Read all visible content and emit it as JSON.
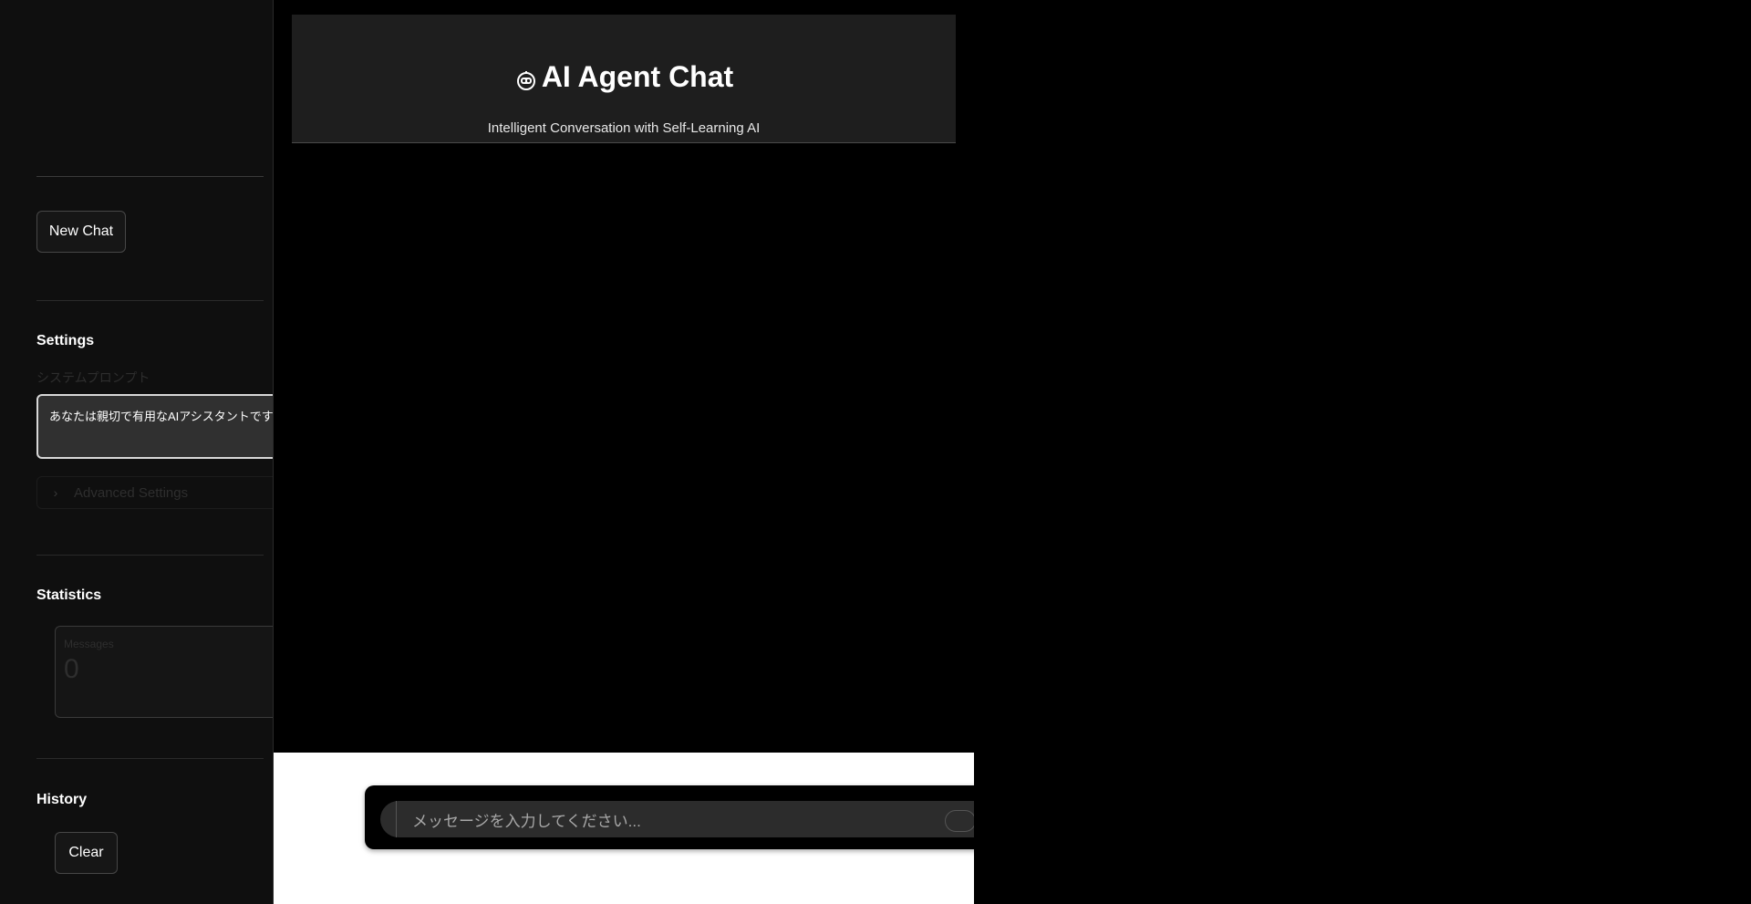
{
  "sidebar": {
    "new_chat_label": "New Chat",
    "settings_title": "Settings",
    "system_prompt_label": "システムプロンプト",
    "system_prompt_value": "あなたは親切で有用なAIアシスタントです。",
    "advanced_settings_label": "Advanced Settings",
    "statistics_title": "Statistics",
    "messages_label": "Messages",
    "messages_value": "0",
    "history_title": "History",
    "clear_label": "Clear"
  },
  "header": {
    "title": "AI Agent Chat",
    "subtitle": "Intelligent Conversation with Self-Learning AI",
    "icon": "robot-icon"
  },
  "chat": {
    "placeholder": "メッセージを入力してください..."
  },
  "colors": {
    "sidebar_bg": "#0f0f0f",
    "main_bg": "#000000",
    "header_bg": "#1e1e1e",
    "input_bg": "#2c2c2c"
  }
}
